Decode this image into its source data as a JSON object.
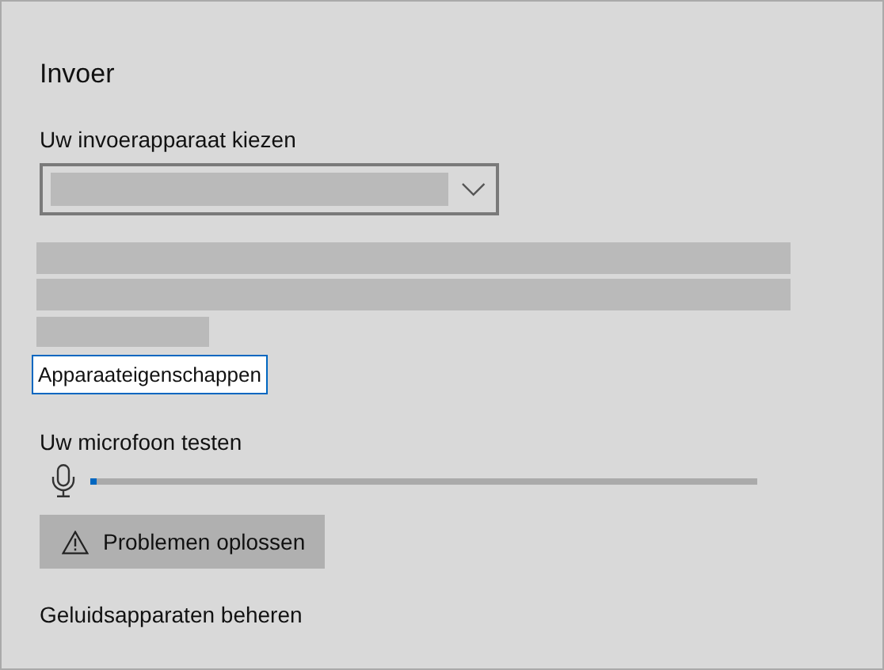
{
  "section": {
    "title": "Invoer"
  },
  "device": {
    "label": "Uw invoerapparaat kiezen",
    "link": "Apparaateigenschappen"
  },
  "mic_test": {
    "label": "Uw microfoon testen",
    "level": 0.01
  },
  "troubleshoot_button": "Problemen oplossen",
  "manage_link": "Geluidsapparaten beheren"
}
